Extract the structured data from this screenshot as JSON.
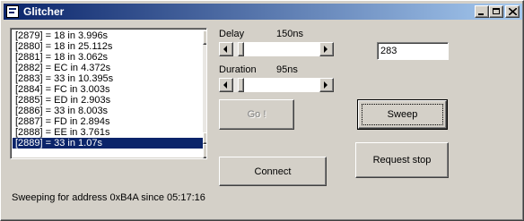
{
  "window": {
    "title": "Glitcher"
  },
  "log": {
    "items": [
      "[2879] = 18 in 3.996s",
      "[2880] = 18 in 25.112s",
      "[2881] = 18 in 3.062s",
      "[2882] = EC in 4.372s",
      "[2883] = 33 in 10.395s",
      "[2884] = FC in 3.003s",
      "[2885] = ED in 2.903s",
      "[2886] = 33 in 8.003s",
      "[2887] = FD in 2.894s",
      "[2888] = EE in 3.761s",
      "[2889] = 33 in 1.07s"
    ],
    "selected_index": 10
  },
  "delay": {
    "label": "Delay",
    "value_text": "150ns",
    "level": 0.06
  },
  "duration": {
    "label": "Duration",
    "value_text": "95ns",
    "level": 0.06
  },
  "address_input": {
    "value": "283"
  },
  "buttons": {
    "go": "Go !",
    "sweep": "Sweep",
    "connect": "Connect",
    "request_stop": "Request stop"
  },
  "status": {
    "text": "Sweeping for address 0xB4A since 05:17:16"
  },
  "colors": {
    "titlebar_start": "#0a246a",
    "titlebar_end": "#a6caf0",
    "face": "#d4d0c8",
    "selection": "#0a246a"
  },
  "icons": {
    "window_icon": "app-icon",
    "minimize": "minimize-icon",
    "maximize": "maximize-icon",
    "close": "close-icon"
  }
}
